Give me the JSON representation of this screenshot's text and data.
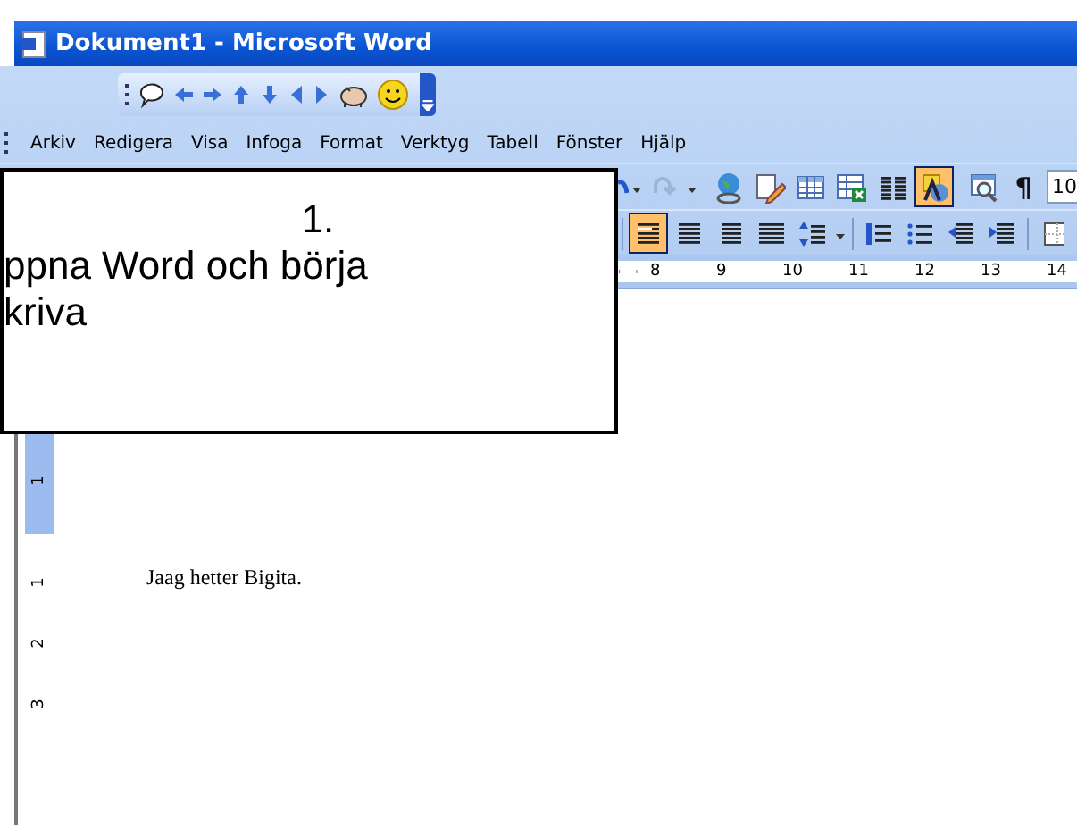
{
  "window": {
    "title": "Dokument1 - Microsoft Word"
  },
  "menu": [
    {
      "label": "Arkiv"
    },
    {
      "label": "Redigera"
    },
    {
      "label": "Visa"
    },
    {
      "label": "Infoga"
    },
    {
      "label": "Format"
    },
    {
      "label": "Verktyg"
    },
    {
      "label": "Tabell"
    },
    {
      "label": "Fönster"
    },
    {
      "label": "Hjälp"
    }
  ],
  "standard_toolbar": {
    "buttons": [
      {
        "kind": "undo",
        "selected": false
      },
      {
        "kind": "drop"
      },
      {
        "kind": "redo",
        "selected": false
      },
      {
        "kind": "drop"
      },
      {
        "kind": "sep"
      },
      {
        "kind": "globe",
        "selected": false
      },
      {
        "kind": "pencil",
        "selected": false
      },
      {
        "kind": "table",
        "selected": false
      },
      {
        "kind": "sheet",
        "selected": false
      },
      {
        "kind": "columns",
        "selected": false
      },
      {
        "kind": "drawing",
        "selected": true
      },
      {
        "kind": "sep"
      },
      {
        "kind": "preview",
        "selected": false
      },
      {
        "kind": "glyph",
        "text": "¶",
        "selected": false
      }
    ],
    "font_size": "10"
  },
  "format_toolbar": {
    "buttons": [
      {
        "kind": "sep"
      },
      {
        "kind": "align-left",
        "selected": true
      },
      {
        "kind": "align-center",
        "selected": false
      },
      {
        "kind": "align-right",
        "selected": false
      },
      {
        "kind": "justify",
        "selected": false
      },
      {
        "kind": "spacing",
        "selected": false
      },
      {
        "kind": "drop"
      },
      {
        "kind": "sep"
      },
      {
        "kind": "numbers",
        "selected": false
      },
      {
        "kind": "bullets",
        "selected": false
      },
      {
        "kind": "outdent",
        "selected": false
      },
      {
        "kind": "indent",
        "selected": false
      },
      {
        "kind": "sep"
      },
      {
        "kind": "border",
        "selected": false
      }
    ]
  },
  "ruler": {
    "numbers": [
      "8",
      "9",
      "10",
      "11",
      "12",
      "13",
      "14"
    ]
  },
  "vertical_ruler": {
    "numbers": [
      "1",
      "1",
      "2",
      "3"
    ]
  },
  "document": {
    "text": "Jaag hetter Bigita."
  },
  "callout": {
    "number": "1.",
    "lines": [
      "ppna Word och börja",
      "kriva"
    ]
  }
}
